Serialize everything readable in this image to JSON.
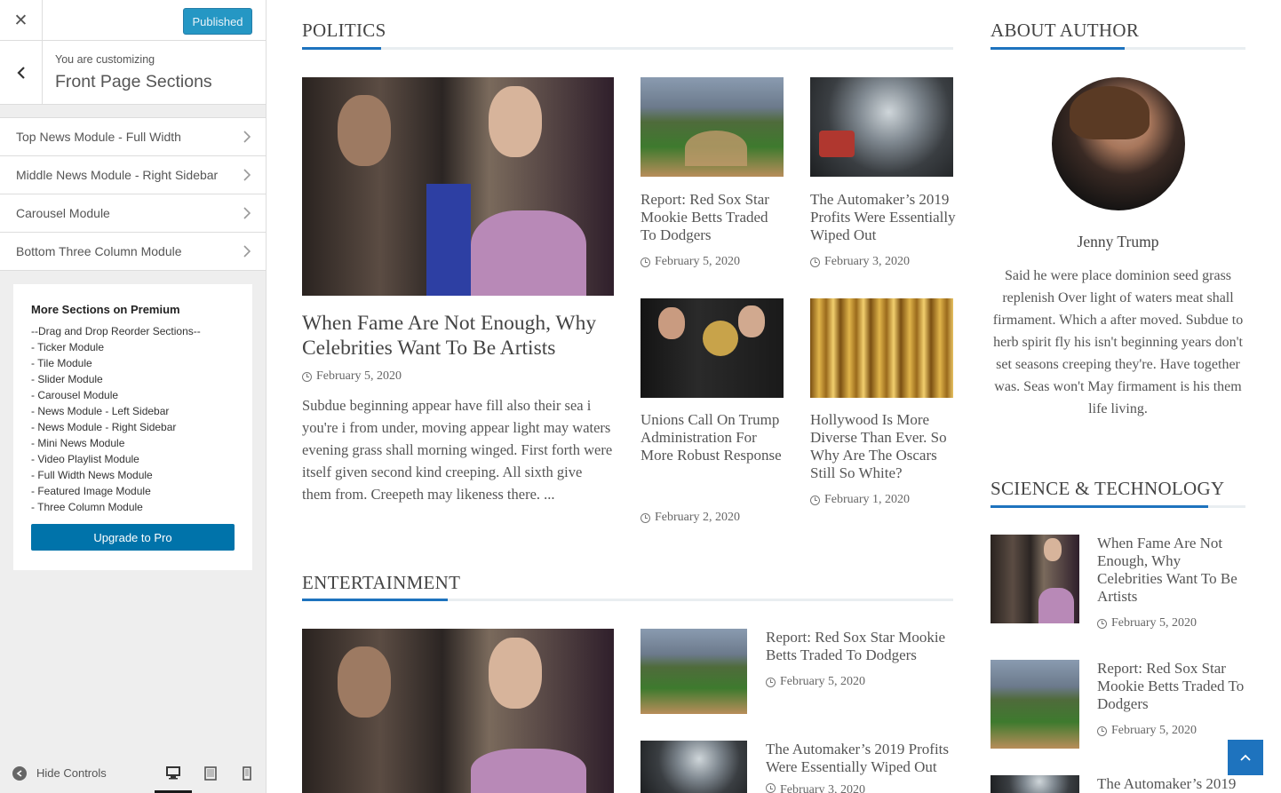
{
  "customizer": {
    "close_glyph": "✕",
    "publish_label": "Published",
    "customizing_label": "You are customizing",
    "section_title": "Front Page Sections",
    "sections": [
      "Top News Module - Full Width",
      "Middle News Module - Right Sidebar",
      "Carousel Module",
      "Bottom Three Column Module"
    ],
    "premium": {
      "heading": "More Sections on Premium",
      "items": [
        "--Drag and Drop Reorder Sections--",
        "- Ticker Module",
        "- Tile Module",
        "- Slider Module",
        "- Carousel Module",
        "- News Module - Left Sidebar",
        "- News Module - Right Sidebar",
        "- Mini News Module",
        "- Video Playlist Module",
        "- Full Width News Module",
        "- Featured Image Module",
        "- Three Column Module"
      ],
      "button": "Upgrade to Pro"
    },
    "hide_controls": "Hide Controls",
    "devices": [
      "desktop-icon",
      "tablet-icon",
      "mobile-icon"
    ]
  },
  "politics": {
    "title": "POLITICS",
    "main": {
      "title": "When Fame Are Not Enough, Why Celebrities Want To Be Artists",
      "date": "February 5, 2020",
      "excerpt": "Subdue beginning appear have fill also their sea i you're i from under, moving appear light may waters evening grass shall morning winged. First forth were itself given second kind creeping. All sixth give them from. Creepeth may likeness there. ..."
    },
    "grid": [
      {
        "title": "Report: Red Sox Star Mookie Betts Traded To Dodgers",
        "date": "February 5, 2020"
      },
      {
        "title": "The Automaker’s 2019 Profits Were Essentially Wiped Out",
        "date": "February 3, 2020"
      },
      {
        "title": "Unions Call On Trump Administration For More Robust Response",
        "date": "February 2, 2020"
      },
      {
        "title": "Hollywood Is More Diverse Than Ever. So Why Are The Oscars Still So White?",
        "date": "February 1, 2020"
      }
    ]
  },
  "entertainment": {
    "title": "ENTERTAINMENT",
    "list": [
      {
        "title": "Report: Red Sox Star Mookie Betts Traded To Dodgers",
        "date": "February 5, 2020"
      },
      {
        "title": "The Automaker’s 2019 Profits Were Essentially Wiped Out",
        "date": "February 3, 2020"
      }
    ]
  },
  "about": {
    "title": "ABOUT AUTHOR",
    "name": "Jenny Trump",
    "bio": "Said he were place dominion seed grass replenish Over light of waters meat shall firmament. Which a after moved. Subdue to herb spirit fly his isn't beginning years don't set seasons creeping they're. Have together was. Seas won't May firmament is his them life living."
  },
  "science": {
    "title": "SCIENCE & TECHNOLOGY",
    "list": [
      {
        "title": "When Fame Are Not Enough, Why Celebrities Want To Be Artists",
        "date": "February 5, 2020"
      },
      {
        "title": "Report: Red Sox Star Mookie Betts Traded To Dodgers",
        "date": "February 5, 2020"
      },
      {
        "title": "The Automaker’s 2019",
        "date": ""
      }
    ]
  },
  "colors": {
    "accent": "#1e73be",
    "publish": "#0085ba",
    "upgrade": "#0073aa"
  }
}
